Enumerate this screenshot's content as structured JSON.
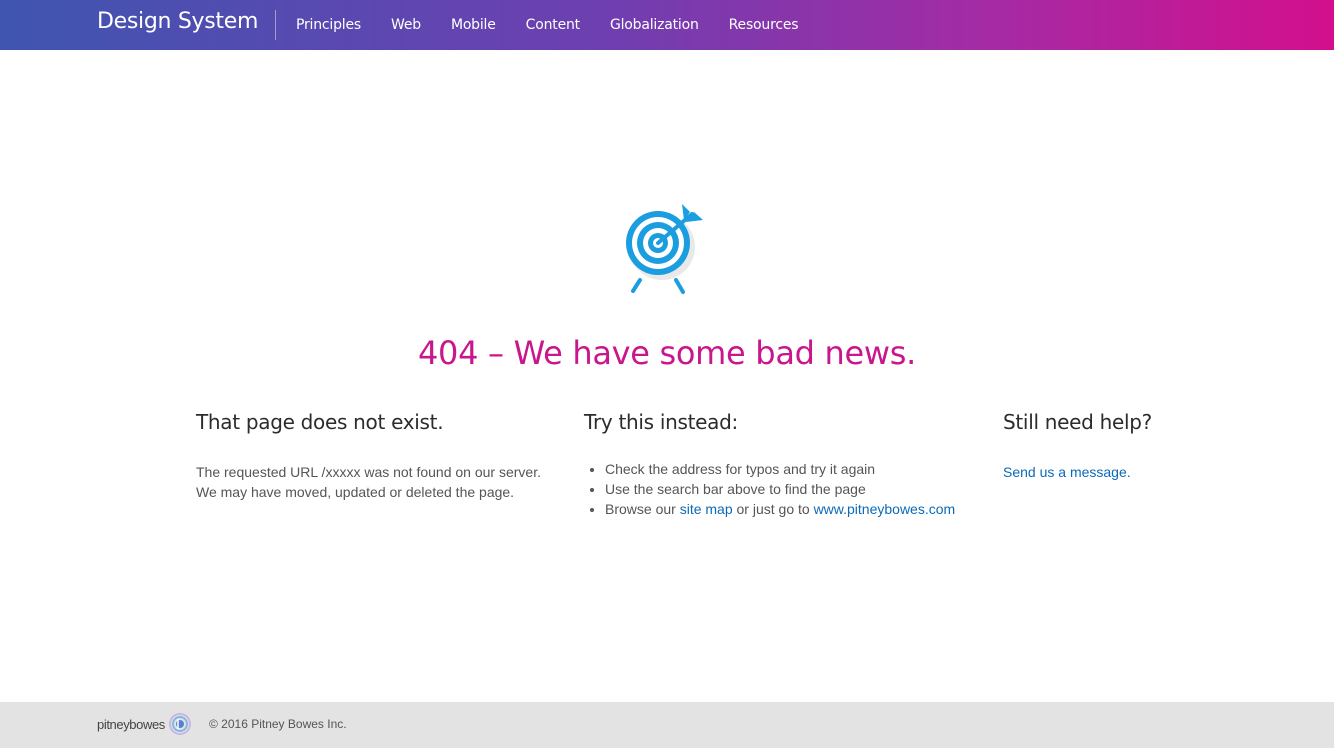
{
  "header": {
    "brand": "Design System",
    "nav": [
      "Principles",
      "Web",
      "Mobile",
      "Content",
      "Globalization",
      "Resources"
    ]
  },
  "error": {
    "icon": "target-icon",
    "headline": "404 – We have some bad news."
  },
  "columns": {
    "not_exist": {
      "title": "That page does not exist.",
      "line1": "The requested URL /xxxxx was not found on our server.",
      "line2": "We may have moved, updated or deleted the page."
    },
    "try_instead": {
      "title": "Try this instead:",
      "item1": "Check the address for typos and try it again",
      "item2": "Use the search bar above to find the page",
      "item3_prefix": "Browse our ",
      "item3_link1": "site map",
      "item3_middle": " or just go to ",
      "item3_link2": "www.pitneybowes.com"
    },
    "help": {
      "title": "Still need help?",
      "link": "Send us a message."
    }
  },
  "footer": {
    "logo_text": "pitneybowes",
    "copyright": "© 2016 Pitney Bowes Inc."
  },
  "colors": {
    "headline": "#c9168c",
    "link": "#0b6ab8",
    "icon": "#1a9ee0",
    "gradient_start": "#3f55b0",
    "gradient_end": "#d30f8d",
    "footer_bg": "#e3e3e3"
  }
}
